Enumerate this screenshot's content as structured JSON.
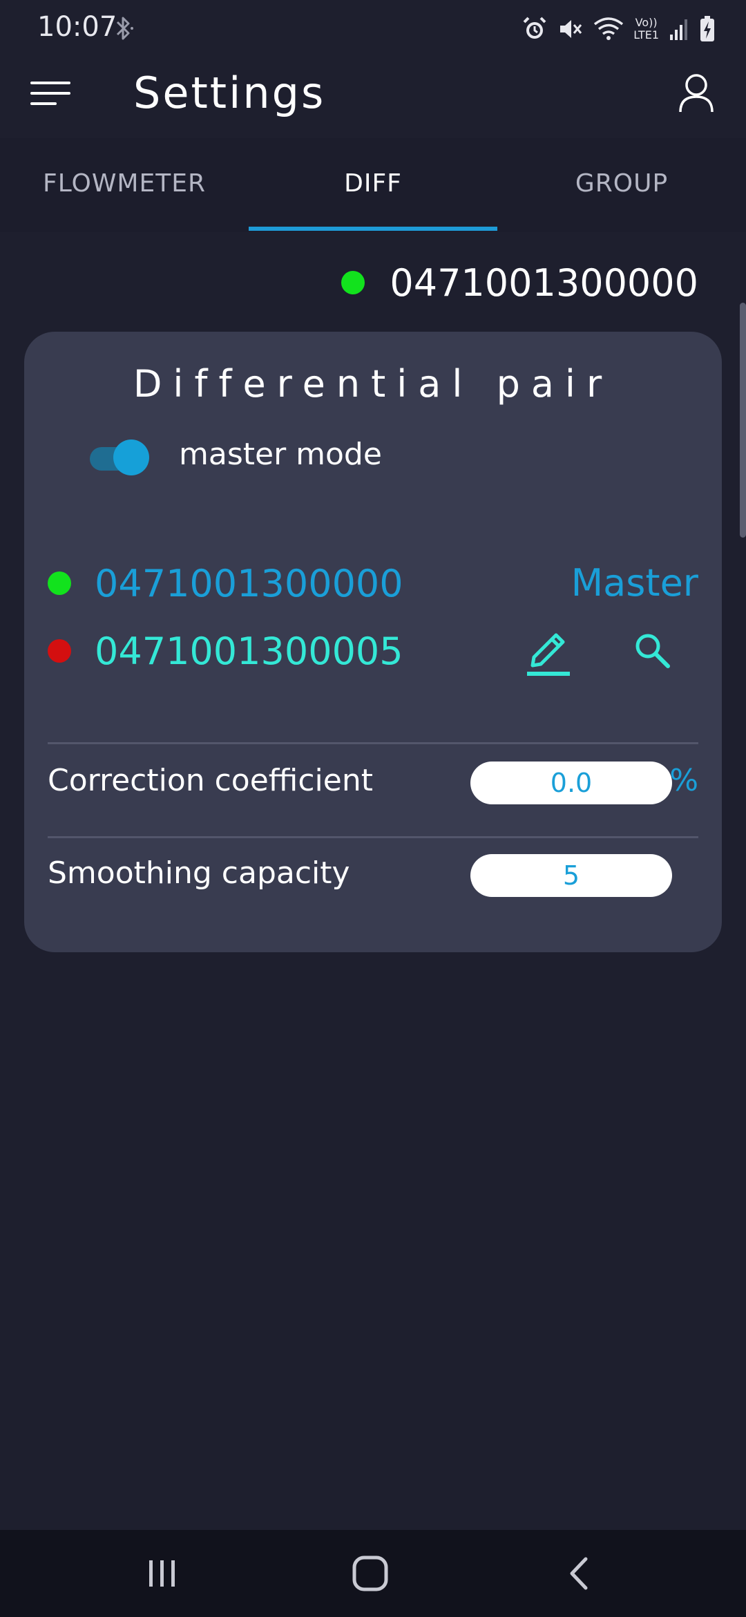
{
  "status_bar": {
    "time": "10:07",
    "network_label_top": "Vo))",
    "network_label_bottom": "LTE1",
    "battery_level": 0.7
  },
  "app_bar": {
    "title": "Settings"
  },
  "tabs": [
    {
      "label": "FLOWMETER",
      "active": false
    },
    {
      "label": "DIFF",
      "active": true
    },
    {
      "label": "GROUP",
      "active": false
    }
  ],
  "device": {
    "serial": "0471001300000",
    "status_color": "#12e21d"
  },
  "card": {
    "title": "Differential pair",
    "master_mode": {
      "label": "master mode",
      "enabled": true
    },
    "master": {
      "serial": "0471001300000",
      "role_label": "Master",
      "status_color": "#12e21d"
    },
    "slave": {
      "serial": "0471001300005",
      "status_color": "#d40f10"
    },
    "correction": {
      "label": "Correction coefficient",
      "value": "0.0",
      "unit": "%"
    },
    "smoothing": {
      "label": "Smoothing capacity",
      "value": "5"
    }
  },
  "colors": {
    "background": "#1e1f2e",
    "card": "#393c50",
    "accent_blue": "#1a9fd8",
    "accent_cyan": "#34e8d6",
    "online_green": "#12e21d",
    "offline_red": "#d40f10"
  },
  "icons": {
    "menu": "menu-icon",
    "account": "account-icon",
    "edit": "pencil-icon",
    "search": "search-icon",
    "nav_recents": "recents-icon",
    "nav_home": "home-icon",
    "nav_back": "back-icon"
  }
}
